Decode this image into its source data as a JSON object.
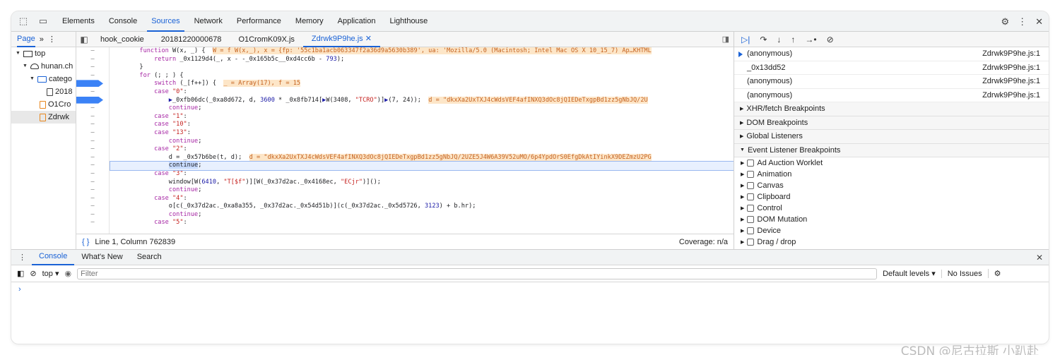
{
  "top_tabs": [
    "Elements",
    "Console",
    "Sources",
    "Network",
    "Performance",
    "Memory",
    "Application",
    "Lighthouse"
  ],
  "active_top_tab": "Sources",
  "navigator": {
    "page_tab": "Page",
    "tree": [
      {
        "label": "top",
        "depth": 0,
        "icon": "frame-icon",
        "expanded": true
      },
      {
        "label": "hunan.ch",
        "depth": 1,
        "icon": "cloud-icon",
        "expanded": true
      },
      {
        "label": "catego",
        "depth": 2,
        "icon": "folder-icon",
        "expanded": true
      },
      {
        "label": "2018",
        "depth": 3,
        "icon": "document-icon"
      },
      {
        "label": "O1Cro",
        "depth": 2,
        "icon": "script-icon"
      },
      {
        "label": "Zdrwk",
        "depth": 2,
        "icon": "script-icon",
        "selected": true
      }
    ]
  },
  "file_tabs": [
    "hook_cookie",
    "20181220000678",
    "O1CromK09X.js",
    "Zdrwk9P9he.js"
  ],
  "active_file_tab": "Zdrwk9P9he.js",
  "code_lines": [
    [
      {
        "t": "        "
      },
      {
        "t": "function",
        "c": "kw"
      },
      {
        "t": " W(x, _) {  "
      },
      {
        "t": "W = f W(x,_), x = {fp: '55c1ba1acb063347f2a36d9a5630b389', ua: 'Mozilla/5.0 (Macintosh; Intel Mac OS X 10_15_7) Ap…KHTML",
        "c": "hl"
      }
    ],
    [
      {
        "t": "            "
      },
      {
        "t": "return",
        "c": "kw"
      },
      {
        "t": " _0x1129d4(_, x - -_0x165b5c__0xd4cc6b - "
      },
      {
        "t": "793",
        "c": "num"
      },
      {
        "t": ");"
      }
    ],
    [
      {
        "t": "        }"
      }
    ],
    [
      {
        "t": "        "
      },
      {
        "t": "for",
        "c": "kw"
      },
      {
        "t": " (; ; ) {"
      }
    ],
    [
      {
        "t": "            "
      },
      {
        "t": "switch",
        "c": "kw"
      },
      {
        "t": " (_[f++]) {  "
      },
      {
        "t": "_ = Array(17), f = 15",
        "c": "hl"
      }
    ],
    [
      {
        "t": "            "
      },
      {
        "t": "case",
        "c": "kw"
      },
      {
        "t": " "
      },
      {
        "t": "\"0\"",
        "c": "str"
      },
      {
        "t": ":"
      }
    ],
    [
      {
        "t": "                "
      },
      {
        "t": "▶",
        "c": "num"
      },
      {
        "t": "_0xfb06dc(_0xa8d672, d, "
      },
      {
        "t": "3600",
        "c": "num"
      },
      {
        "t": " * _0x8fb714["
      },
      {
        "t": "▶",
        "c": "num"
      },
      {
        "t": "W(3408, "
      },
      {
        "t": "\"TCRO\"",
        "c": "str"
      },
      {
        "t": ")]"
      },
      {
        "t": "▶",
        "c": "num"
      },
      {
        "t": "(7, 24));  "
      },
      {
        "t": "d = \"dkxXa2UxTXJ4cWdsVEF4afINXQ3dOc8jQIEDeTxgpBd1zz5gNbJQ/2U",
        "c": "hl"
      }
    ],
    [
      {
        "t": "                "
      },
      {
        "t": "continue",
        "c": "kw"
      },
      {
        "t": ";"
      }
    ],
    [
      {
        "t": "            "
      },
      {
        "t": "case",
        "c": "kw"
      },
      {
        "t": " "
      },
      {
        "t": "\"1\"",
        "c": "str"
      },
      {
        "t": ":"
      }
    ],
    [
      {
        "t": "            "
      },
      {
        "t": "case",
        "c": "kw"
      },
      {
        "t": " "
      },
      {
        "t": "\"10\"",
        "c": "str"
      },
      {
        "t": ":"
      }
    ],
    [
      {
        "t": "            "
      },
      {
        "t": "case",
        "c": "kw"
      },
      {
        "t": " "
      },
      {
        "t": "\"13\"",
        "c": "str"
      },
      {
        "t": ":"
      }
    ],
    [
      {
        "t": "                "
      },
      {
        "t": "continue",
        "c": "kw"
      },
      {
        "t": ";"
      }
    ],
    [
      {
        "t": "            "
      },
      {
        "t": "case",
        "c": "kw"
      },
      {
        "t": " "
      },
      {
        "t": "\"2\"",
        "c": "str"
      },
      {
        "t": ":"
      }
    ],
    [
      {
        "t": "                d = _0x57b6be(t, d);  "
      },
      {
        "t": "d = \"dkxXa2UxTXJ4cWdsVEF4afINXQ3dOc8jQIEDeTxgpBd1zz5gNbJQ/2UZE5J4W6A39V52uMO/6p4YpdOrS0EfgDkAtIYinkX9DEZmzU2PG",
        "c": "hl"
      }
    ],
    [
      {
        "t": "                "
      },
      {
        "t": "continue",
        "c": "sel"
      },
      {
        "t": ";"
      }
    ],
    [
      {
        "t": "            "
      },
      {
        "t": "case",
        "c": "kw"
      },
      {
        "t": " "
      },
      {
        "t": "\"3\"",
        "c": "str"
      },
      {
        "t": ":"
      }
    ],
    [
      {
        "t": "                window[W("
      },
      {
        "t": "6410",
        "c": "num"
      },
      {
        "t": ", "
      },
      {
        "t": "\"T[$f\"",
        "c": "str"
      },
      {
        "t": ")][W(_0x37d2ac._0x4168ec, "
      },
      {
        "t": "\"ECjr\"",
        "c": "str"
      },
      {
        "t": ")]();"
      }
    ],
    [
      {
        "t": "                "
      },
      {
        "t": "continue",
        "c": "kw"
      },
      {
        "t": ";"
      }
    ],
    [
      {
        "t": "            "
      },
      {
        "t": "case",
        "c": "kw"
      },
      {
        "t": " "
      },
      {
        "t": "\"4\"",
        "c": "str"
      },
      {
        "t": ":"
      }
    ],
    [
      {
        "t": "                o[c(_0x37d2ac._0xa8a355, _0x37d2ac._0x54d51b)](c(_0x37d2ac._0x5d5726, "
      },
      {
        "t": "3123",
        "c": "num"
      },
      {
        "t": ") + b.hr);"
      }
    ],
    [
      {
        "t": "                "
      },
      {
        "t": "continue",
        "c": "kw"
      },
      {
        "t": ";"
      }
    ],
    [
      {
        "t": "            "
      },
      {
        "t": "case",
        "c": "kw"
      },
      {
        "t": " "
      },
      {
        "t": "\"5\"",
        "c": "str"
      },
      {
        "t": ":"
      }
    ]
  ],
  "status": {
    "position": "Line 1, Column 762839",
    "coverage": "Coverage: n/a"
  },
  "call_stack": [
    {
      "name": "(anonymous)",
      "loc": "Zdrwk9P9he.js:1",
      "current": true
    },
    {
      "name": "_0x13dd52",
      "loc": "Zdrwk9P9he.js:1"
    },
    {
      "name": "(anonymous)",
      "loc": "Zdrwk9P9he.js:1"
    },
    {
      "name": "(anonymous)",
      "loc": "Zdrwk9P9he.js:1"
    }
  ],
  "sections": [
    "XHR/fetch Breakpoints",
    "DOM Breakpoints",
    "Global Listeners",
    "Event Listener Breakpoints"
  ],
  "event_listeners": [
    "Ad Auction Worklet",
    "Animation",
    "Canvas",
    "Clipboard",
    "Control",
    "DOM Mutation",
    "Device",
    "Drag / drop"
  ],
  "drawer_tabs": [
    "Console",
    "What's New",
    "Search"
  ],
  "console": {
    "context": "top",
    "filter_placeholder": "Filter",
    "levels": "Default levels ▾",
    "issues": "No Issues",
    "prompt": "›"
  },
  "watermark": "CSDN @尼古拉斯 小趴赴"
}
